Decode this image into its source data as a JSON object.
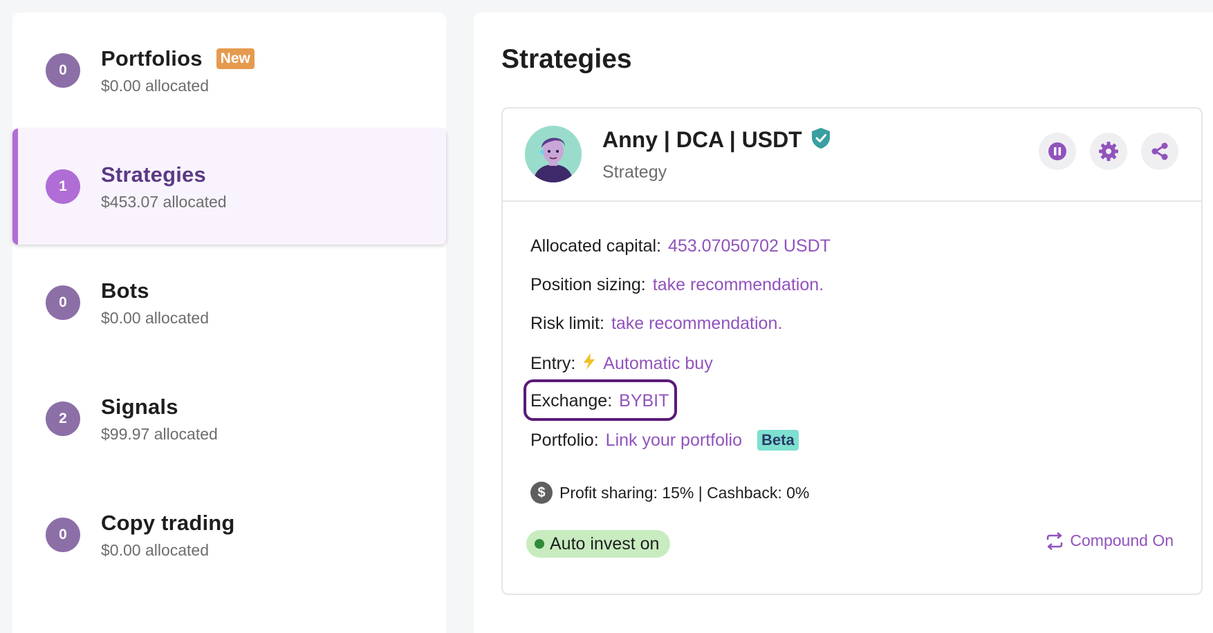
{
  "sidebar": {
    "items": [
      {
        "count": "0",
        "title": "Portfolios",
        "tag": "New",
        "allocated": "$0.00 allocated"
      },
      {
        "count": "1",
        "title": "Strategies",
        "allocated": "$453.07 allocated"
      },
      {
        "count": "0",
        "title": "Bots",
        "allocated": "$0.00 allocated"
      },
      {
        "count": "2",
        "title": "Signals",
        "allocated": "$99.97 allocated"
      },
      {
        "count": "0",
        "title": "Copy trading",
        "allocated": "$0.00 allocated"
      }
    ]
  },
  "main": {
    "title": "Strategies",
    "card": {
      "name": "Anny | DCA | USDT",
      "type": "Strategy",
      "fields": {
        "allocated_capital": {
          "label": "Allocated capital:",
          "value": "453.07050702 USDT"
        },
        "position_sizing": {
          "label": "Position sizing:",
          "value": "take recommendation."
        },
        "risk_limit": {
          "label": "Risk limit:",
          "value": "take recommendation."
        },
        "entry": {
          "label": "Entry:",
          "icon": "lightning-icon",
          "value": "Automatic buy"
        },
        "exchange": {
          "label": "Exchange:",
          "value": "BYBIT"
        },
        "portfolio": {
          "label": "Portfolio:",
          "value": "Link your portfolio",
          "tag": "Beta"
        }
      },
      "profit_sharing": "Profit sharing: 15% | Cashback: 0%",
      "auto_invest": "Auto invest on",
      "compound": "Compound On"
    }
  },
  "colors": {
    "accent": "#9153bd",
    "active_bar": "#b06dd6",
    "badge": "#8d6fa8",
    "new_tag": "#e59a4e",
    "beta_tag": "#7ee0d0",
    "auto_invest_bg": "#c8ecc0",
    "highlight_border": "#5a1a78"
  }
}
